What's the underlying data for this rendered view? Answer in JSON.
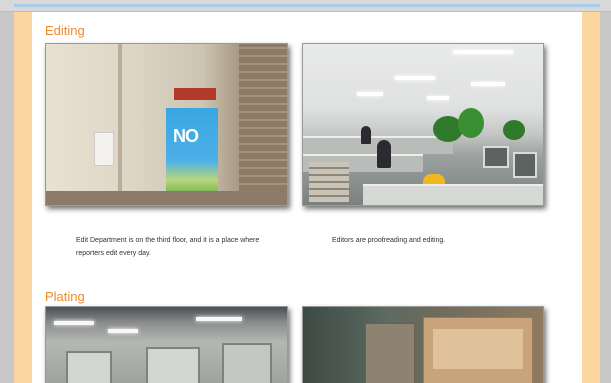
{
  "sections": [
    {
      "title": "Editing",
      "captions": [
        "Edit Department is on the third floor, and it is a place where reporters edit every day.",
        "Editors are proofreading and editing."
      ],
      "photos": [
        {
          "description_icon": "hallway-photo",
          "poster_text": "NO"
        },
        {
          "description_icon": "office-photo"
        }
      ]
    },
    {
      "title": "Plating",
      "photos": [
        {
          "description_icon": "plating-room-photo"
        },
        {
          "description_icon": "boxes-photo"
        }
      ]
    }
  ],
  "colors": {
    "accent": "#f08a2a",
    "page_border": "#fbd79f",
    "background": "#c8c8c8"
  }
}
